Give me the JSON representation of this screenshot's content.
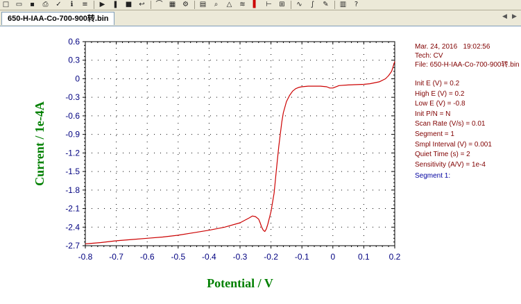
{
  "window": {
    "tab_title": "650-H-IAA-Co-700-900转.bin"
  },
  "toolbar": {
    "icons": [
      "new-icon",
      "open-icon",
      "save-icon",
      "print-icon",
      "check-icon",
      "info-icon",
      "list-icon",
      "play-icon",
      "pause-icon",
      "stop-icon",
      "return-icon",
      "clip-icon",
      "graph-icon",
      "settings-icon",
      "grid-icon",
      "zoom-icon",
      "peak-icon",
      "overlay-icon",
      "color-icon",
      "cursor-icon",
      "filter-icon",
      "wave-icon",
      "math-icon",
      "pen-icon",
      "table-icon",
      "help-icon"
    ]
  },
  "info": {
    "date": "Mar. 24, 2016",
    "time": "19:02:56",
    "tech": "Tech: CV",
    "file": "File: 650-H-IAA-Co-700-900转.bin",
    "params": [
      "Init E (V) = 0.2",
      "High E (V) = 0.2",
      "Low E (V) = -0.8",
      "Init P/N = N",
      "Scan Rate (V/s) = 0.01",
      "Segment = 1",
      "Smpl Interval (V) = 0.001",
      "Quiet Time (s) = 2",
      "Sensitivity (A/V) = 1e-4"
    ],
    "segment_label": "Segment 1:"
  },
  "colors": {
    "curve": "#cc0000",
    "axis_title": "#008000",
    "ticks": "#000080",
    "info_text": "#800000",
    "segment_text": "#0000a0"
  },
  "chart_data": {
    "type": "line",
    "xlabel": "Potential / V",
    "ylabel": "Current / 1e-4A",
    "xlim": [
      -0.8,
      0.2
    ],
    "ylim": [
      -2.7,
      0.6
    ],
    "x_ticks": [
      -0.8,
      -0.7,
      -0.6,
      -0.5,
      -0.4,
      -0.3,
      -0.2,
      -0.1,
      0,
      0.1,
      0.2
    ],
    "x_tick_labels": [
      "-0.8",
      "-0.7",
      "-0.6",
      "-0.5",
      "-0.4",
      "-0.3",
      "-0.2",
      "-0.1",
      "0",
      "0.1",
      "0.2"
    ],
    "y_ticks": [
      0.6,
      0.3,
      0,
      -0.3,
      -0.6,
      -0.9,
      -1.2,
      -1.5,
      -1.8,
      -2.1,
      -2.4,
      -2.7
    ],
    "y_tick_labels": [
      "0.6",
      "0.3",
      "0",
      "-0.3",
      "-0.6",
      "-0.9",
      "-1.2",
      "-1.5",
      "-1.8",
      "-2.1",
      "-2.4",
      "-2.7"
    ],
    "grid": true,
    "series": [
      {
        "x": [
          0.2,
          0.195,
          0.19,
          0.18,
          0.17,
          0.15,
          0.12,
          0.1,
          0.05,
          0.02,
          0.0,
          -0.01,
          -0.02,
          -0.04,
          -0.06,
          -0.08,
          -0.1,
          -0.11,
          -0.12,
          -0.13,
          -0.14,
          -0.15,
          -0.16,
          -0.165,
          -0.17,
          -0.175,
          -0.18,
          -0.185,
          -0.19,
          -0.2,
          -0.21,
          -0.215,
          -0.22,
          -0.225,
          -0.23,
          -0.235,
          -0.24,
          -0.25,
          -0.26,
          -0.27,
          -0.3,
          -0.35,
          -0.4,
          -0.45,
          -0.5,
          -0.55,
          -0.6,
          -0.65,
          -0.7,
          -0.75,
          -0.8
        ],
        "y": [
          0.28,
          0.2,
          0.12,
          0.05,
          0.0,
          -0.05,
          -0.08,
          -0.09,
          -0.1,
          -0.11,
          -0.15,
          -0.15,
          -0.13,
          -0.12,
          -0.12,
          -0.12,
          -0.13,
          -0.14,
          -0.16,
          -0.2,
          -0.27,
          -0.37,
          -0.55,
          -0.7,
          -0.9,
          -1.1,
          -1.35,
          -1.6,
          -1.85,
          -2.15,
          -2.35,
          -2.43,
          -2.47,
          -2.45,
          -2.4,
          -2.33,
          -2.27,
          -2.23,
          -2.22,
          -2.25,
          -2.33,
          -2.4,
          -2.45,
          -2.49,
          -2.53,
          -2.56,
          -2.58,
          -2.6,
          -2.62,
          -2.65,
          -2.67
        ]
      }
    ]
  }
}
